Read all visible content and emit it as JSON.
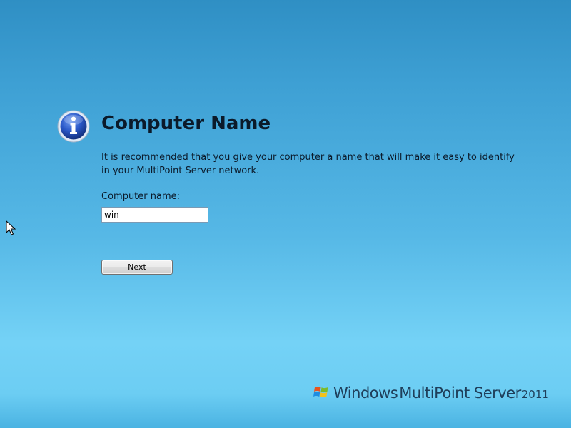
{
  "page": {
    "title": "Computer Name",
    "description": "It is recommended that you give your computer a name that will make it easy to identify in your MultiPoint Server network.",
    "icon": "info-icon"
  },
  "form": {
    "computer_name_label": "Computer name:",
    "computer_name_value": "win",
    "next_label": "Next"
  },
  "brand": {
    "windows": "Windows",
    "product": "MultiPoint Server",
    "year": "2011",
    "logo_icon": "windows-flag-icon"
  },
  "colors": {
    "background_top": "#2f8fc4",
    "background_bottom": "#74d2f6",
    "text": "#0b1a2a",
    "icon_blue": "#1f4fb8"
  }
}
